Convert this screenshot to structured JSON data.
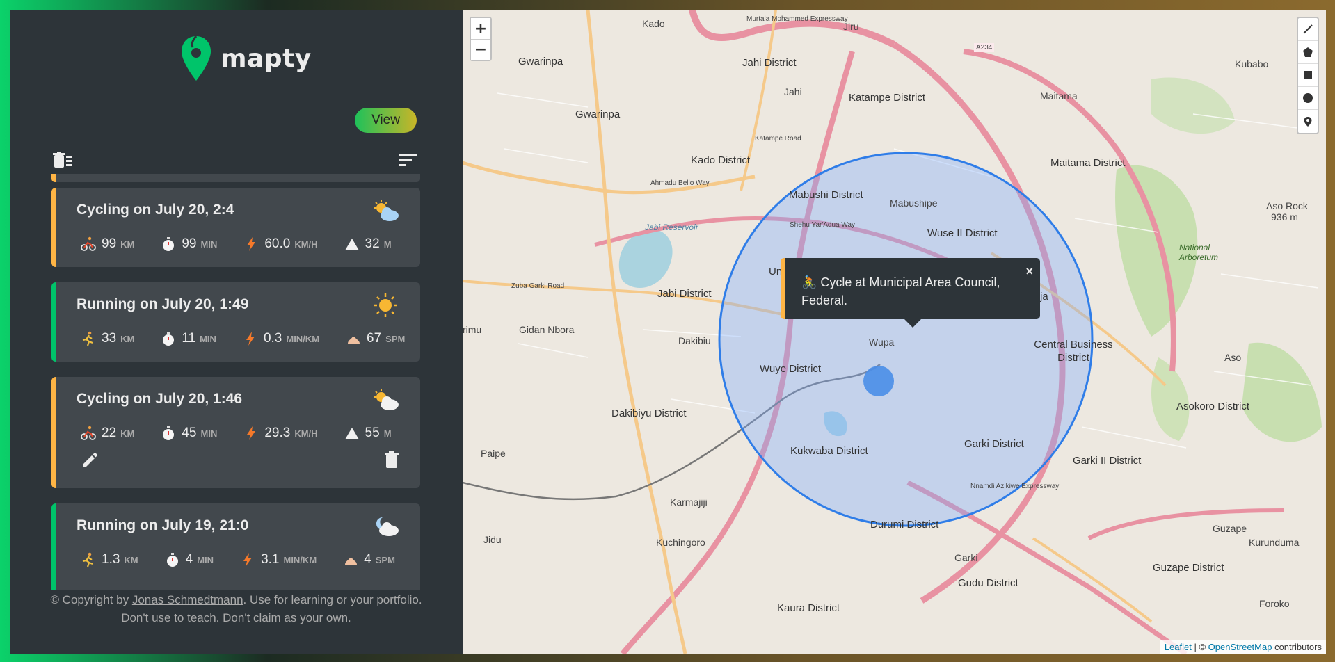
{
  "app": {
    "logo_text": "mapty",
    "view_button": "View"
  },
  "workouts": [
    {
      "type": "cycling",
      "title": "Cycling on July 20, 2:4",
      "weather": "partly-cloudy",
      "stats": [
        {
          "icon": "cyclist-icon",
          "value": "99",
          "unit": "KM"
        },
        {
          "icon": "stopwatch-icon",
          "value": "99",
          "unit": "MIN"
        },
        {
          "icon": "lightning-icon",
          "value": "60.0",
          "unit": "KM/H"
        },
        {
          "icon": "mountain-icon",
          "value": "32",
          "unit": "M"
        }
      ]
    },
    {
      "type": "running",
      "title": "Running on July 20, 1:49",
      "weather": "sunny",
      "stats": [
        {
          "icon": "runner-icon",
          "value": "33",
          "unit": "KM"
        },
        {
          "icon": "stopwatch-icon",
          "value": "11",
          "unit": "MIN"
        },
        {
          "icon": "lightning-icon",
          "value": "0.3",
          "unit": "MIN/KM"
        },
        {
          "icon": "footprint-icon",
          "value": "67",
          "unit": "SPM"
        }
      ]
    },
    {
      "type": "cycling",
      "title": "Cycling on July 20, 1:46",
      "weather": "partly-cloudy",
      "stats": [
        {
          "icon": "cyclist-icon",
          "value": "22",
          "unit": "KM"
        },
        {
          "icon": "stopwatch-icon",
          "value": "45",
          "unit": "MIN"
        },
        {
          "icon": "lightning-icon",
          "value": "29.3",
          "unit": "KM/H"
        },
        {
          "icon": "mountain-icon",
          "value": "55",
          "unit": "M"
        }
      ]
    },
    {
      "type": "running",
      "title": "Running on July 19, 21:0",
      "weather": "cloudy-night",
      "stats": [
        {
          "icon": "runner-icon",
          "value": "1.3",
          "unit": "KM"
        },
        {
          "icon": "stopwatch-icon",
          "value": "4",
          "unit": "MIN"
        },
        {
          "icon": "lightning-icon",
          "value": "3.1",
          "unit": "MIN/KM"
        },
        {
          "icon": "footprint-icon",
          "value": "4",
          "unit": "SPM"
        }
      ]
    }
  ],
  "footer": {
    "prefix": "© Copyright by ",
    "author": "Jonas Schmedtmann",
    "suffix": ". Use for learning or your portfolio.",
    "line2": "Don't use to teach. Don't claim as your own."
  },
  "map": {
    "zoom_in": "+",
    "zoom_out": "−",
    "popup_text": "🚴 Cycle at Municipal Area Council, Federal.",
    "popup_close": "×",
    "attribution_leaflet": "Leaflet",
    "attribution_sep": " | © ",
    "attribution_osm": "OpenStreetMap",
    "attribution_suffix": " contributors",
    "places": [
      "Kado",
      "Gwarinpa",
      "Jahi District",
      "Jiru",
      "Jahi",
      "Katampe District",
      "Maitama",
      "Kubabo",
      "Kado District",
      "Maitama District",
      "Mabushi District",
      "Mabushipe",
      "Wuse II District",
      "Aso Rock",
      "936 m",
      "National Arboretum",
      "Jabi District",
      "Jabi Reservoir",
      "Gidan Nbora",
      "rimu",
      "Dakibiu",
      "Wupa",
      "Central Business District",
      "Wuye District",
      "Asokoro District",
      "Aso",
      "Dakibiyu District",
      "Kukwaba District",
      "Garki District",
      "Garki II District",
      "Paipe",
      "Karmajiji",
      "Durumi District",
      "Kuchingoro",
      "Jidu",
      "Guzape",
      "Kurunduma",
      "Garki",
      "Gudu District",
      "Guzape District",
      "Kaura District",
      "Foroko",
      "Gwarinpa",
      "Un",
      "ja"
    ],
    "roads": [
      "Murtala Mohammed Expressway",
      "A234",
      "Ahmadu Bello Way",
      "Shehu Yar'Adua Way",
      "Zuba Garki Road",
      "Nnamdi Azikiwe Expressway",
      "Katampe Road"
    ]
  },
  "colors": {
    "cycling": "#ffb545",
    "running": "#00c46a",
    "sidebar_bg": "#2d3439",
    "card_bg": "#42484d"
  }
}
